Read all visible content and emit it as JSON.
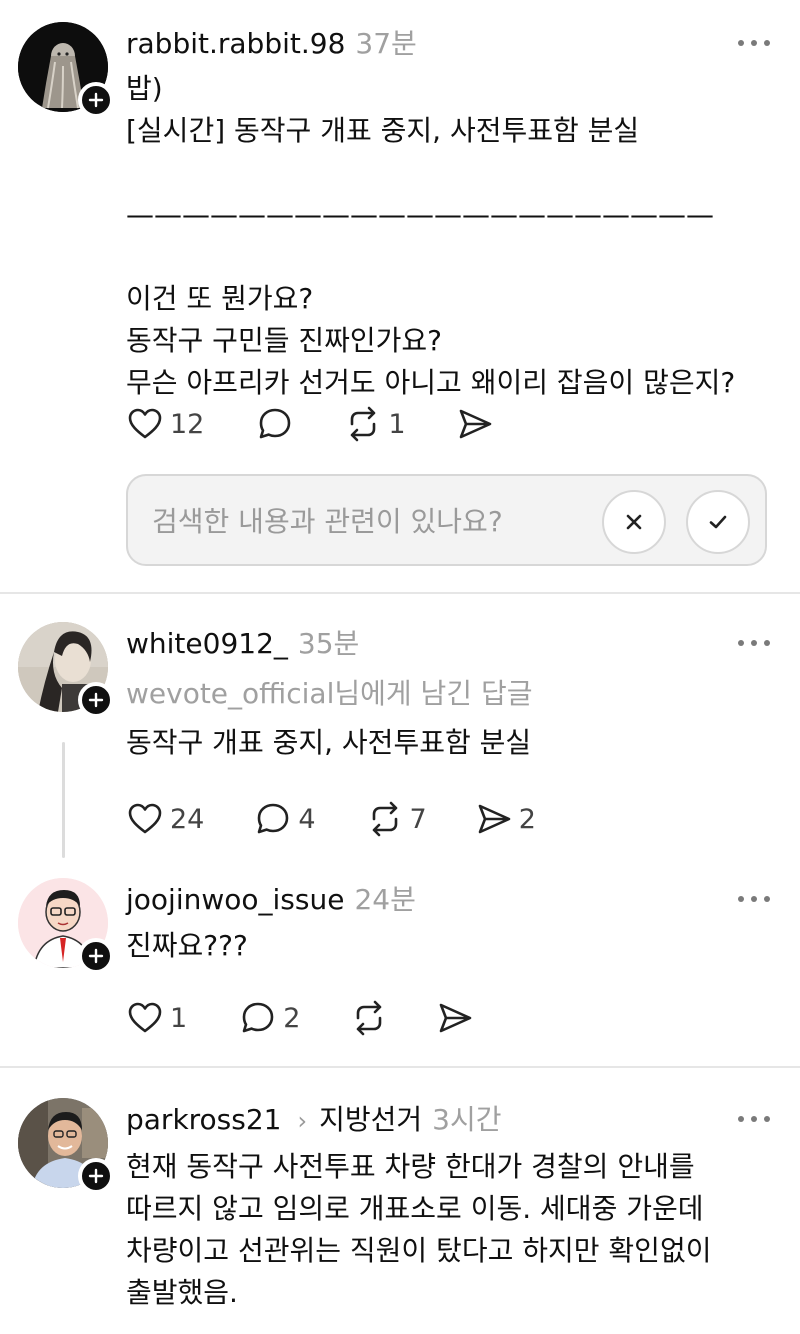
{
  "posts": [
    {
      "username": "rabbit.rabbit.98",
      "time": "37분",
      "body": "밥)\n[실시간] 동작구 개표 중지, 사전투표함 분실\n\n—————————————————————\n\n이건 또 뭔가요?\n동작구 구민들 진짜인가요?\n무슨 아프리카 선거도 아니고 왜이리 잡음이 많은지?",
      "likes": "12",
      "comments": "",
      "reposts": "1",
      "shares": ""
    },
    {
      "username": "white0912_",
      "time": "35분",
      "reply_to_user": "wevote_official",
      "reply_to_suffix": "님에게 남긴 답글",
      "body": "동작구 개표 중지, 사전투표함 분실",
      "likes": "24",
      "comments": "4",
      "reposts": "7",
      "shares": "2"
    },
    {
      "username": "joojinwoo_issue",
      "time": "24분",
      "body": "진짜요???",
      "likes": "1",
      "comments": "2",
      "reposts": "",
      "shares": ""
    },
    {
      "username": "parkross21",
      "topic": "지방선거",
      "time": "3시간",
      "body": "현재 동작구 사전투표 차량 한대가 경찰의 안내를\n따르지 않고 임의로 개표소로 이동. 세대중 가운데\n차량이고 선관위는 직원이 탔다고 하지만 확인없이\n출발했음."
    }
  ],
  "feedback": {
    "question": "검색한 내용과 관련이 있나요?"
  },
  "icons": {
    "like": "heart-icon",
    "comment": "comment-bubble-icon",
    "repost": "repost-icon",
    "share": "send-icon",
    "more": "more-icon",
    "follow": "plus-icon",
    "dismiss": "close-icon",
    "confirm": "check-icon",
    "chevron": "chevron-right-icon"
  }
}
